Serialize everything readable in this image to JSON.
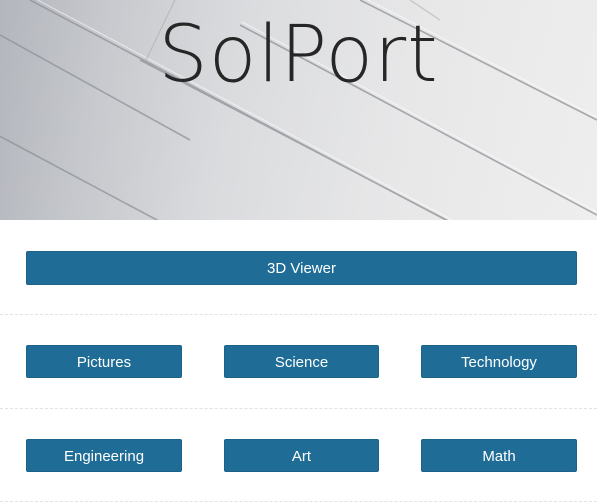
{
  "header": {
    "title": "SolPort"
  },
  "featured": {
    "label": "3D Viewer"
  },
  "row1": [
    {
      "label": "Pictures"
    },
    {
      "label": "Science"
    },
    {
      "label": "Technology"
    }
  ],
  "row2": [
    {
      "label": "Engineering"
    },
    {
      "label": "Art"
    },
    {
      "label": "Math"
    }
  ],
  "colors": {
    "button": "#1f6d97",
    "button_text": "#ffffff",
    "title": "#262626"
  }
}
